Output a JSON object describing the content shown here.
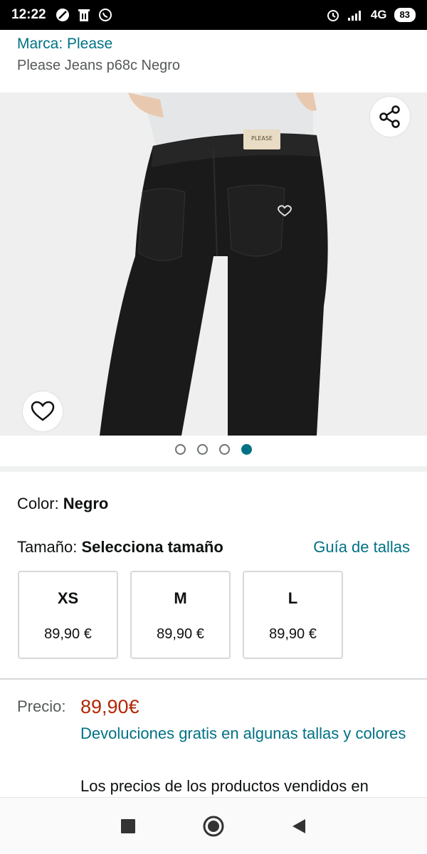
{
  "status_bar": {
    "time": "12:22",
    "network": "4G",
    "battery": "83",
    "icons": [
      "compass-icon",
      "trash-icon",
      "whatsapp-icon",
      "alarm-icon",
      "signal-icon"
    ]
  },
  "product": {
    "brand": "Marca: Please",
    "title": "Please Jeans p68c Negro",
    "label_text": "PLEASE",
    "carousel": {
      "count": 4,
      "active_index": 3
    }
  },
  "color": {
    "label": "Color: ",
    "value": "Negro"
  },
  "size": {
    "label": "Tamaño: ",
    "value": "Selecciona tamaño",
    "guide_link": "Guía de tallas",
    "options": [
      {
        "name": "XS",
        "price": "89,90 €"
      },
      {
        "name": "M",
        "price": "89,90 €"
      },
      {
        "name": "L",
        "price": "89,90 €"
      }
    ]
  },
  "pricing": {
    "label": "Precio:",
    "value": "89,90€",
    "returns": "Devoluciones gratis en algunas tallas y colores",
    "disclaimer": "Los precios de los productos vendidos en"
  },
  "colors": {
    "link": "#007185",
    "price": "#b12704",
    "active_dot": "#007185"
  },
  "nav": [
    "recents-square-icon",
    "home-circle-icon",
    "back-triangle-icon"
  ]
}
